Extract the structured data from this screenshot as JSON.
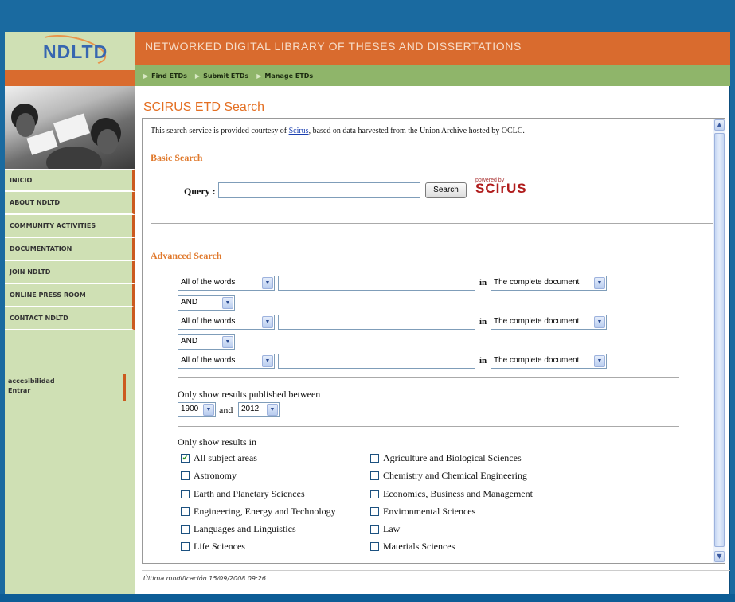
{
  "site": {
    "logo": "NDLTD",
    "title": "NETWORKED DIGITAL LIBRARY OF THESES AND DISSERTATIONS"
  },
  "menu": [
    "Find ETDs",
    "Submit ETDs",
    "Manage ETDs"
  ],
  "sidebar": {
    "items": [
      "INICIO",
      "ABOUT NDLTD",
      "COMMUNITY ACTIVITIES",
      "DOCUMENTATION",
      "JOIN NDLTD",
      "ONLINE PRESS ROOM",
      "CONTACT NDLTD"
    ],
    "tools": [
      "accesibilidad",
      "Entrar"
    ]
  },
  "page": {
    "title": "SCIRUS ETD Search",
    "intro_prefix": "This search service is provided courtesy of ",
    "intro_link": "Scirus",
    "intro_suffix": ", based on data harvested from the Union Archive hosted by OCLC."
  },
  "basic": {
    "heading": "Basic Search",
    "query_label": "Query :",
    "query_value": "",
    "button": "Search",
    "powered_small": "powered by",
    "powered_logo": "SCIrUS"
  },
  "advanced": {
    "heading": "Advanced Search",
    "rows": [
      {
        "words": "All of the words",
        "in": "in",
        "scope": "The complete document"
      },
      {
        "words": "All of the words",
        "in": "in",
        "scope": "The complete document"
      },
      {
        "words": "All of the words",
        "in": "in",
        "scope": "The complete document"
      }
    ],
    "operators": [
      "AND",
      "AND"
    ],
    "date_label": "Only show results published between",
    "date_from": "1900",
    "date_and": "and",
    "date_to": "2012",
    "subjects_label": "Only show results in",
    "subjects_left": [
      {
        "label": "All subject areas",
        "checked": true
      },
      {
        "label": "Astronomy",
        "checked": false
      },
      {
        "label": "Earth and Planetary Sciences",
        "checked": false
      },
      {
        "label": "Engineering, Energy and Technology",
        "checked": false
      },
      {
        "label": "Languages and Linguistics",
        "checked": false
      },
      {
        "label": "Life Sciences",
        "checked": false
      }
    ],
    "subjects_right": [
      {
        "label": "Agriculture and Biological Sciences",
        "checked": false
      },
      {
        "label": "Chemistry and Chemical Engineering",
        "checked": false
      },
      {
        "label": "Economics, Business and Management",
        "checked": false
      },
      {
        "label": "Environmental Sciences",
        "checked": false
      },
      {
        "label": "Law",
        "checked": false
      },
      {
        "label": "Materials Sciences",
        "checked": false
      }
    ]
  },
  "footer": "Última modificación 15/09/2008 09:26",
  "colors": {
    "outer": "#1a6aa0",
    "orange": "#d96b2e",
    "menu_green": "#8fb56a",
    "sidebar_green": "#cfe0b4",
    "heading_orange": "#e07a2e"
  }
}
